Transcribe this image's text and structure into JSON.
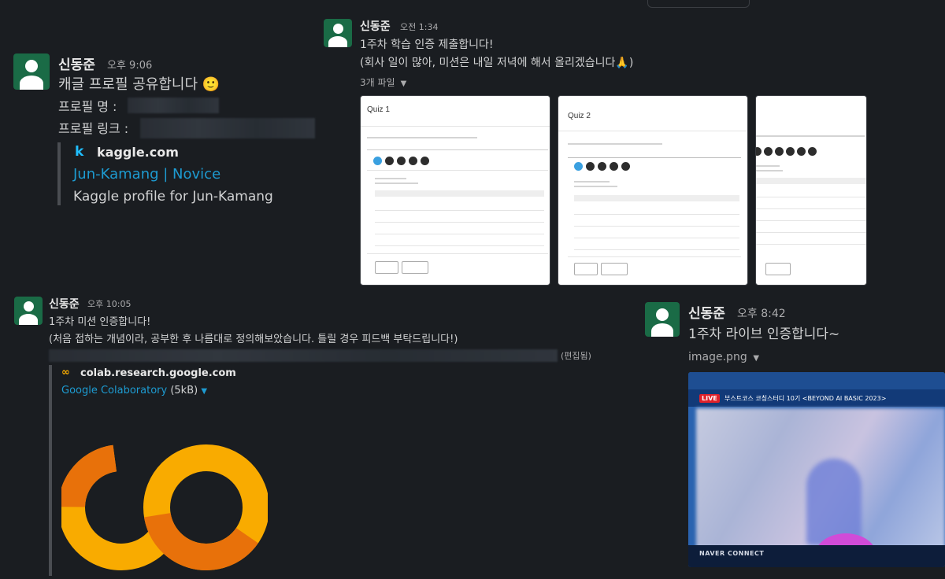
{
  "messages": {
    "kaggle": {
      "author": "신동준",
      "time": "오후 9:06",
      "line1": "캐글 프로필 공유합니다 🙂",
      "profile_name_label": "프로필 명 :",
      "profile_link_label": "프로필 링크 :",
      "unfurl": {
        "site": "kaggle.com",
        "title": "Jun-Kamang | Novice",
        "description": "Kaggle profile for Jun-Kamang",
        "icon": "kaggle-k-icon"
      }
    },
    "week1": {
      "author": "신동준",
      "time": "오전 1:34",
      "line1": "1주차 학습 인증 제출합니다!",
      "line2": "(회사 일이 많아, 미션은 내일 저녁에 해서 올리겠습니다🙏)",
      "files_label": "3개 파일",
      "files": [
        {
          "title": "Quiz 1"
        },
        {
          "title": "Quiz 2"
        },
        {
          "title": ""
        }
      ]
    },
    "mission": {
      "author": "신동준",
      "time": "오후 10:05",
      "line1": "1주차 미션 인증합니다!",
      "line2": "(처음 접하는 개념이라, 공부한 후 나름대로 정의해보았습니다. 틀릴 경우 피드백 부탁드립니다!)",
      "edited": "(편집됨)",
      "unfurl": {
        "site": "colab.research.google.com",
        "title": "Google Colaboratory",
        "size": "(5kB)",
        "icon": "colab-icon"
      }
    },
    "live": {
      "author": "신동준",
      "time": "오후 8:42",
      "line1": "1주차 라이브 인증합니다~",
      "file_name": "image.png",
      "live_badge": "LIVE",
      "stream_title": "부스트코스 코칭스터디 10기 <BEYOND AI BASIC 2023>",
      "brand": "NAVER CONNECT"
    }
  },
  "colors": {
    "background": "#1a1d21",
    "link": "#1d9bd1",
    "avatar": "#1a6b46",
    "colab_orange": "#f9ab00",
    "colab_dark": "#e8710a"
  }
}
